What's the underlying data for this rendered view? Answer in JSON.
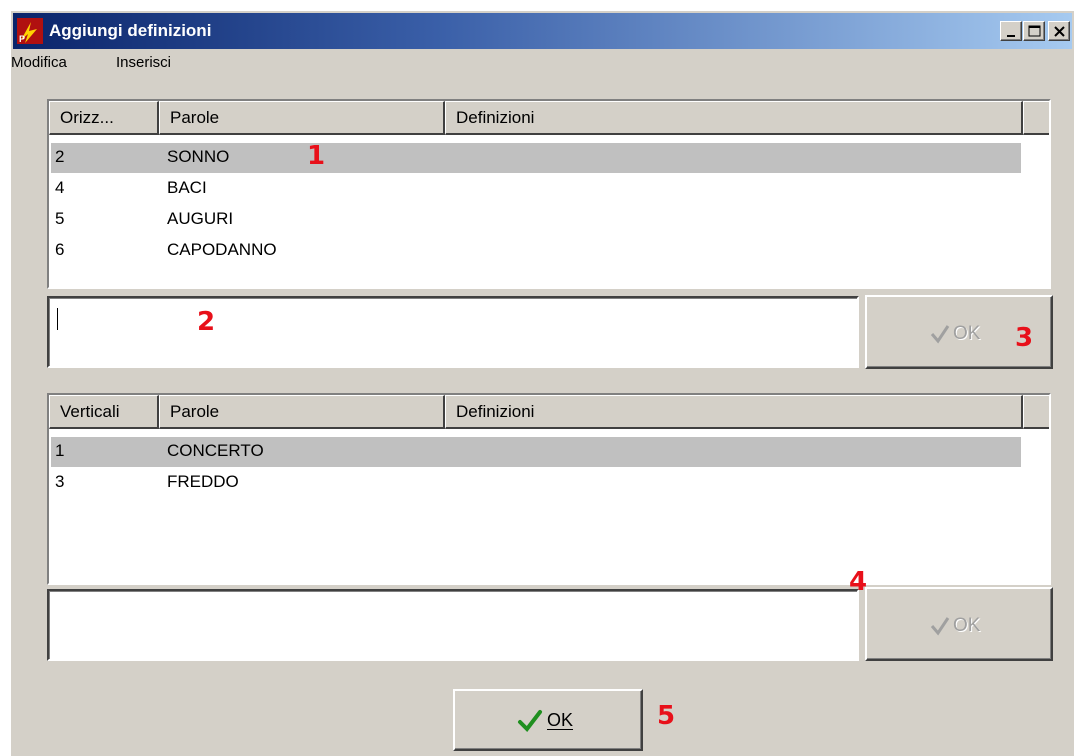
{
  "window": {
    "title": "Aggiungi definizioni",
    "controls": {
      "minimize": "_",
      "maximize": "□",
      "close": "×"
    }
  },
  "menu": {
    "items": [
      "Modifica",
      "Inserisci"
    ]
  },
  "horizontal": {
    "columns": [
      "Orizz...",
      "Parole",
      "Definizioni"
    ],
    "rows": [
      {
        "num": "2",
        "word": "SONNO",
        "definition": "",
        "selected": true
      },
      {
        "num": "4",
        "word": "BACI",
        "definition": ""
      },
      {
        "num": "5",
        "word": "AUGURI",
        "definition": ""
      },
      {
        "num": "6",
        "word": "CAPODANNO",
        "definition": ""
      }
    ],
    "definition_input": "",
    "ok_label": "OK"
  },
  "vertical": {
    "columns": [
      "Verticali",
      "Parole",
      "Definizioni"
    ],
    "rows": [
      {
        "num": "1",
        "word": "CONCERTO",
        "definition": "",
        "selected": true
      },
      {
        "num": "3",
        "word": "FREDDO",
        "definition": ""
      }
    ],
    "definition_input": "",
    "ok_label": "OK"
  },
  "footer": {
    "ok_label": "OK",
    "ok_accel": "O"
  },
  "annotations": [
    "1",
    "2",
    "3",
    "4",
    "5"
  ],
  "colors": {
    "titlebar_start": "#0a246a",
    "titlebar_end": "#a6caf0",
    "annotation": "#e8101a",
    "check_green": "#1f8f1f"
  }
}
